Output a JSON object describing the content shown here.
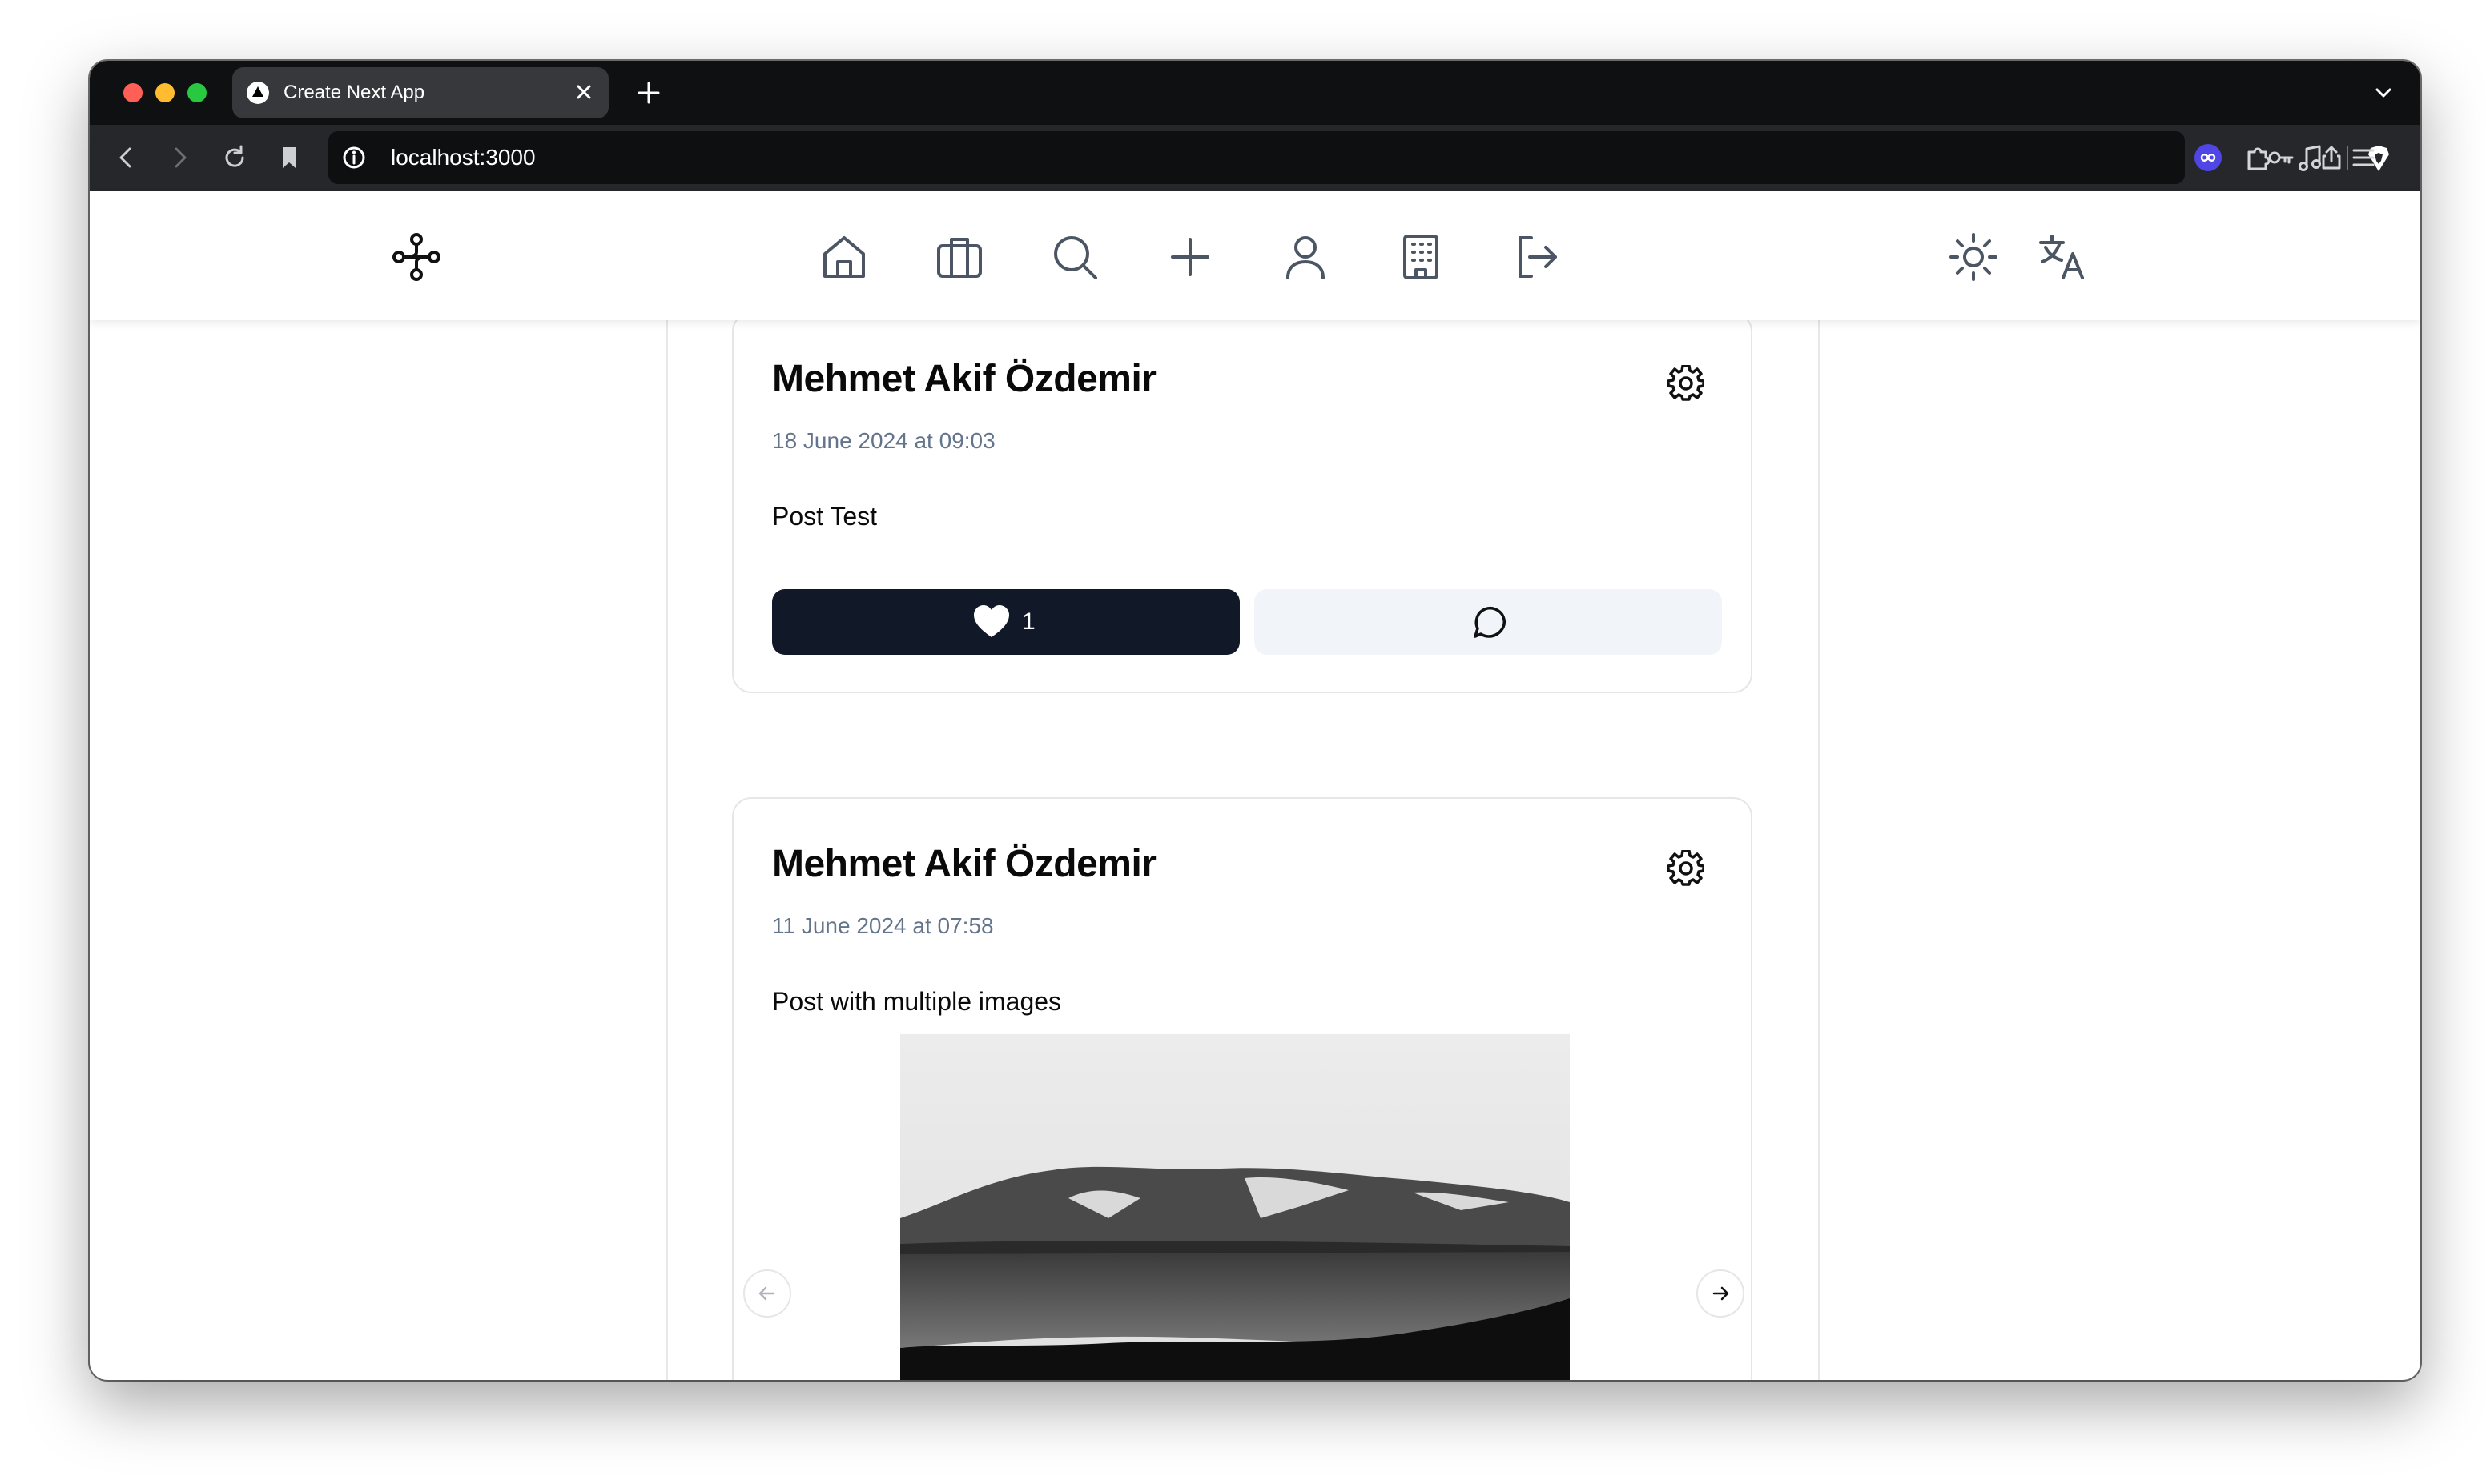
{
  "browser": {
    "tab_title": "Create Next App",
    "url": "localhost:3000"
  },
  "icons": {
    "logo": "workflow-logo-icon",
    "nav": [
      "home-icon",
      "briefcase-icon",
      "search-icon",
      "plus-icon",
      "user-icon",
      "building-icon",
      "logout-icon"
    ],
    "theme": "sun-icon",
    "language": "translate-icon",
    "settings": "gear-icon",
    "like": "heart-icon",
    "comment": "message-circle-icon"
  },
  "colors": {
    "like_button_bg": "#111827",
    "comment_button_bg": "#f1f5f9",
    "date_text": "#64748b"
  },
  "posts": [
    {
      "author": "Mehmet Akif Özdemir",
      "date": "18 June 2024 at 09:03",
      "text": "Post Test",
      "likes": "1"
    },
    {
      "author": "Mehmet Akif Özdemir",
      "date": "11 June 2024 at 07:58",
      "text": "Post with multiple images"
    }
  ]
}
